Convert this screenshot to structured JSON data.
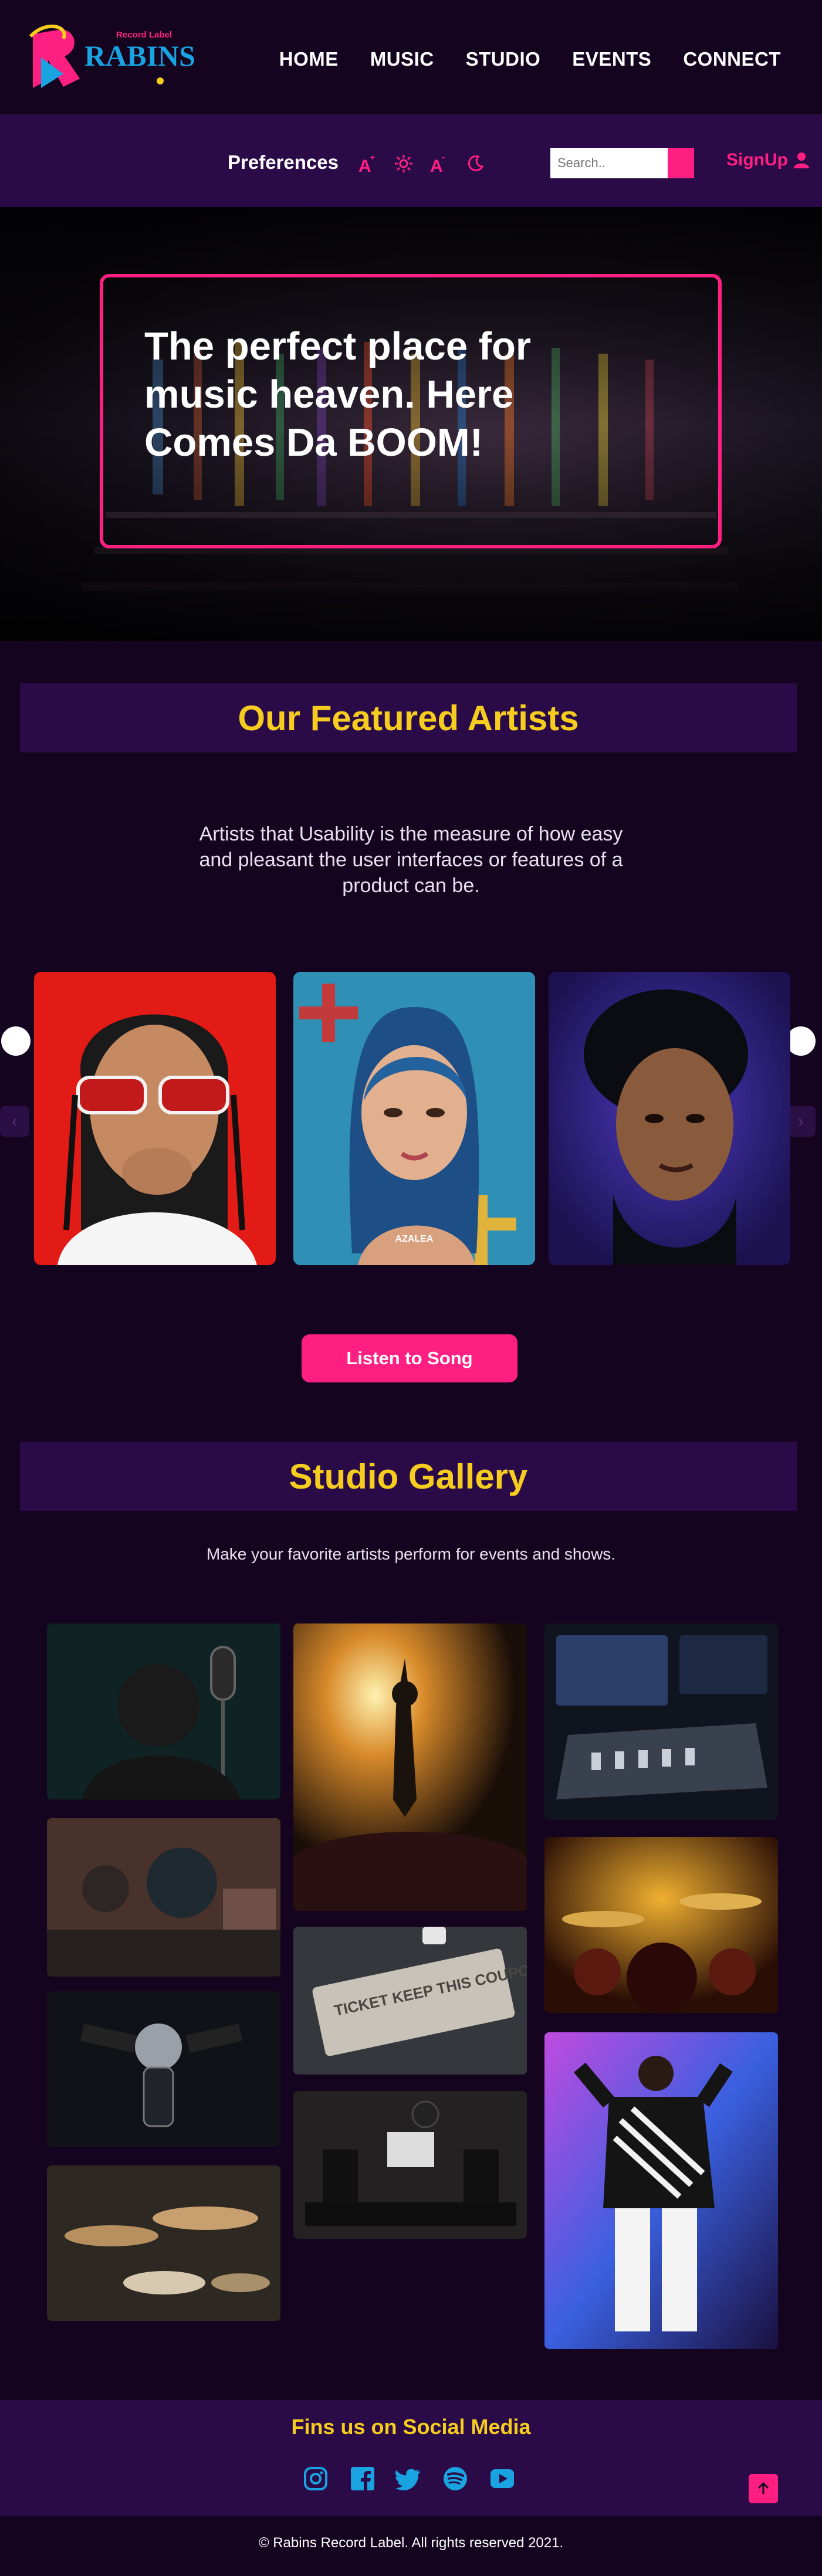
{
  "brand": {
    "name": "RABINS",
    "tagline": "Record Label"
  },
  "nav": {
    "items": [
      "HOME",
      "MUSIC",
      "STUDIO",
      "EVENTS",
      "CONNECT"
    ]
  },
  "preferences": {
    "label": "Preferences",
    "icons": [
      "text-increase-icon",
      "brightness-icon",
      "text-decrease-icon",
      "dark-mode-icon"
    ]
  },
  "search": {
    "placeholder": "Search.."
  },
  "account": {
    "signup_label": "SignUp"
  },
  "hero": {
    "title": "The perfect place for music heaven. Here Comes Da BOOM!"
  },
  "featured": {
    "heading": "Our Featured Artists",
    "intro": "Artists that Usability is the measure of how easy and pleasant the user interfaces or features of a product can be.",
    "artists": [
      {
        "image": "artist-red-sunglasses"
      },
      {
        "image": "artist-blue-hair",
        "caption": "AZALEA"
      },
      {
        "image": "artist-purple-portrait"
      }
    ],
    "cta_label": "Listen to Song"
  },
  "gallery": {
    "heading": "Studio Gallery",
    "intro": "Make your favorite artists perform for events and shows.",
    "ticket_text": "TICKET KEEP THIS COUPON"
  },
  "footer": {
    "social_heading": "Fins us on Social Media",
    "social_icons": [
      "instagram-icon",
      "facebook-icon",
      "twitter-icon",
      "spotify-icon",
      "youtube-icon"
    ],
    "copyright": "© Rabins Record Label. All rights reserved 2021."
  },
  "colors": {
    "accent": "#ff1f82",
    "heading": "#f6cd1f",
    "background": "#14041f",
    "panel": "#2a0b47"
  }
}
